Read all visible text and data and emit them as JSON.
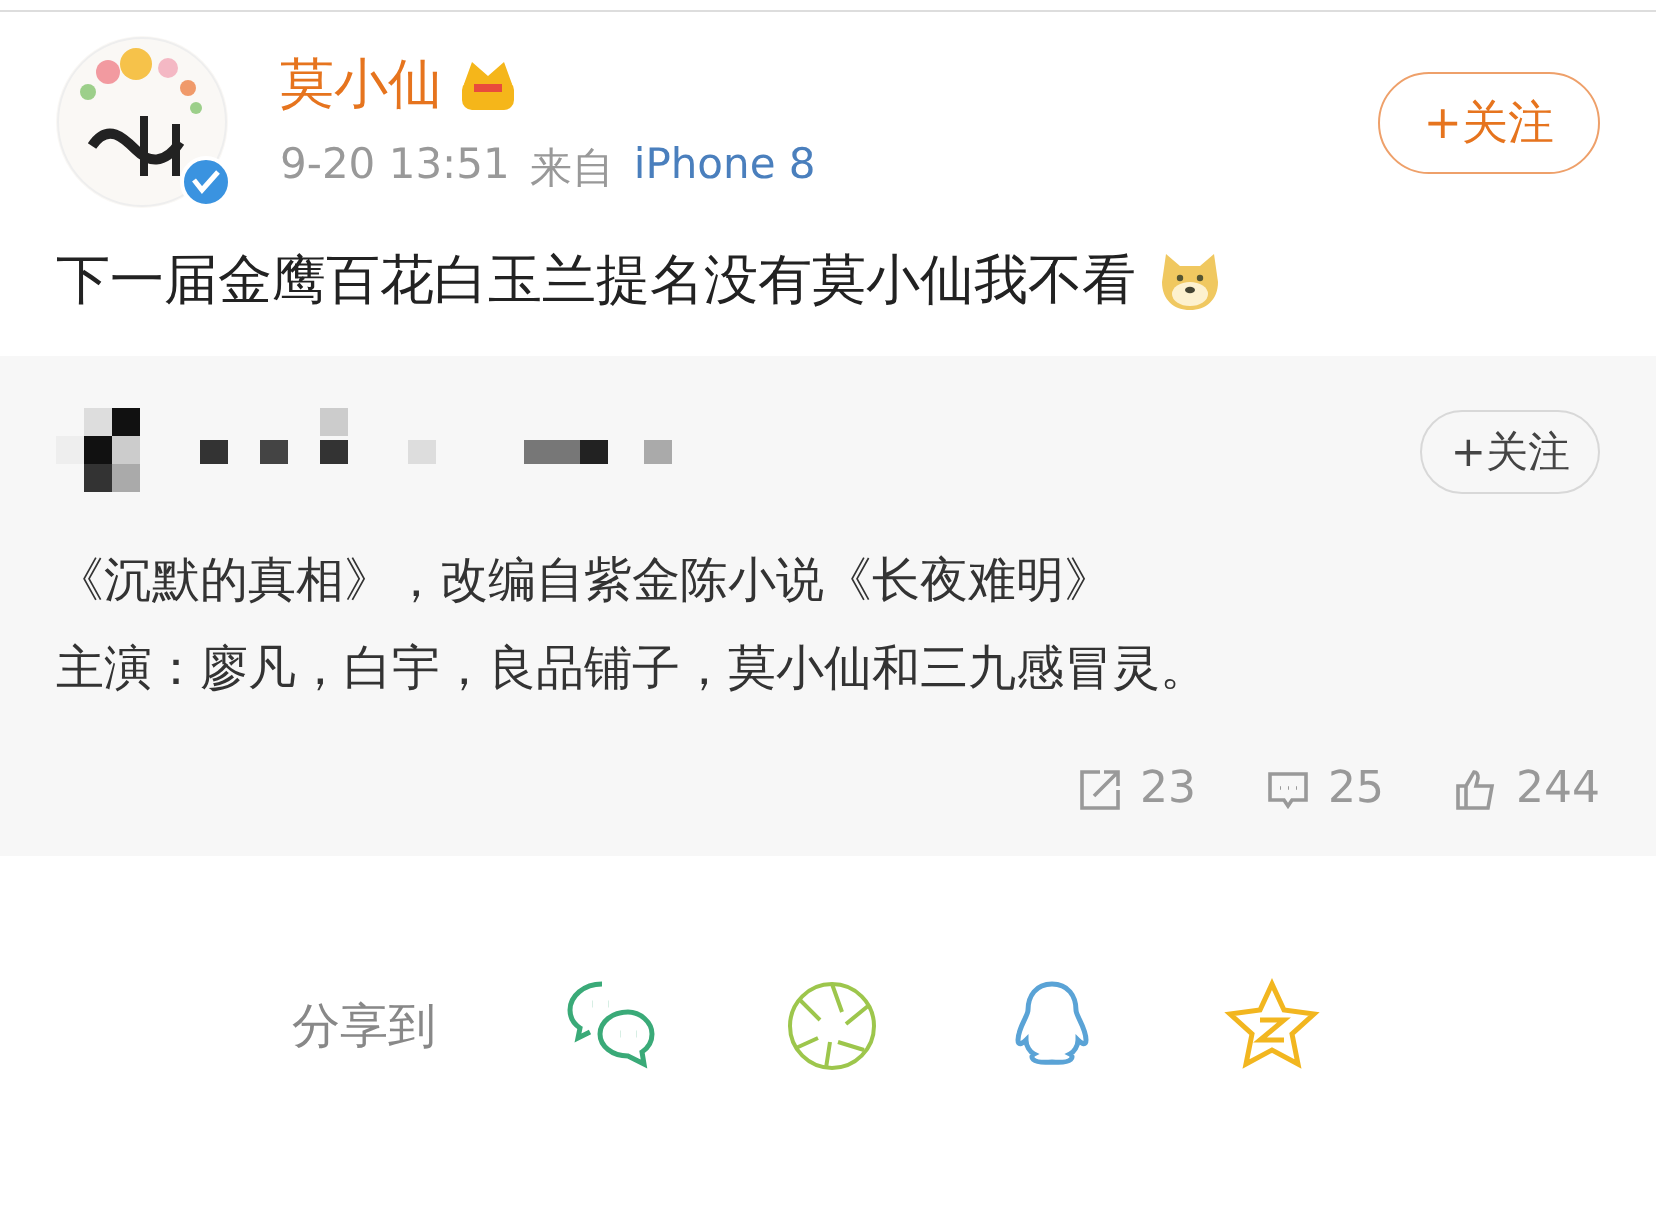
{
  "post": {
    "author": "莫小仙",
    "timestamp": "9-20 13:51",
    "source_prefix": "来自",
    "source": "iPhone 8",
    "follow_button": "+关注",
    "text": "下一届金鹰百花白玉兰提名没有莫小仙我不看"
  },
  "repost": {
    "follow_button": "+关注",
    "lines": [
      "《沉默的真相》，改编自紫金陈小说《长夜难明》",
      "主演：廖凡，白宇，良品铺子，莫小仙和三九感冒灵。"
    ],
    "stats": [
      {
        "kind": "share",
        "count": "23"
      },
      {
        "kind": "comment",
        "count": "25"
      },
      {
        "kind": "like",
        "count": "244"
      }
    ]
  },
  "share": {
    "label": "分享到",
    "targets": [
      {
        "kind": "chat",
        "color": "#3aaa78"
      },
      {
        "kind": "aperture",
        "color": "#9dc64c"
      },
      {
        "kind": "penguin",
        "color": "#5aa3d6"
      },
      {
        "kind": "star",
        "color": "#f2b61f"
      }
    ]
  }
}
